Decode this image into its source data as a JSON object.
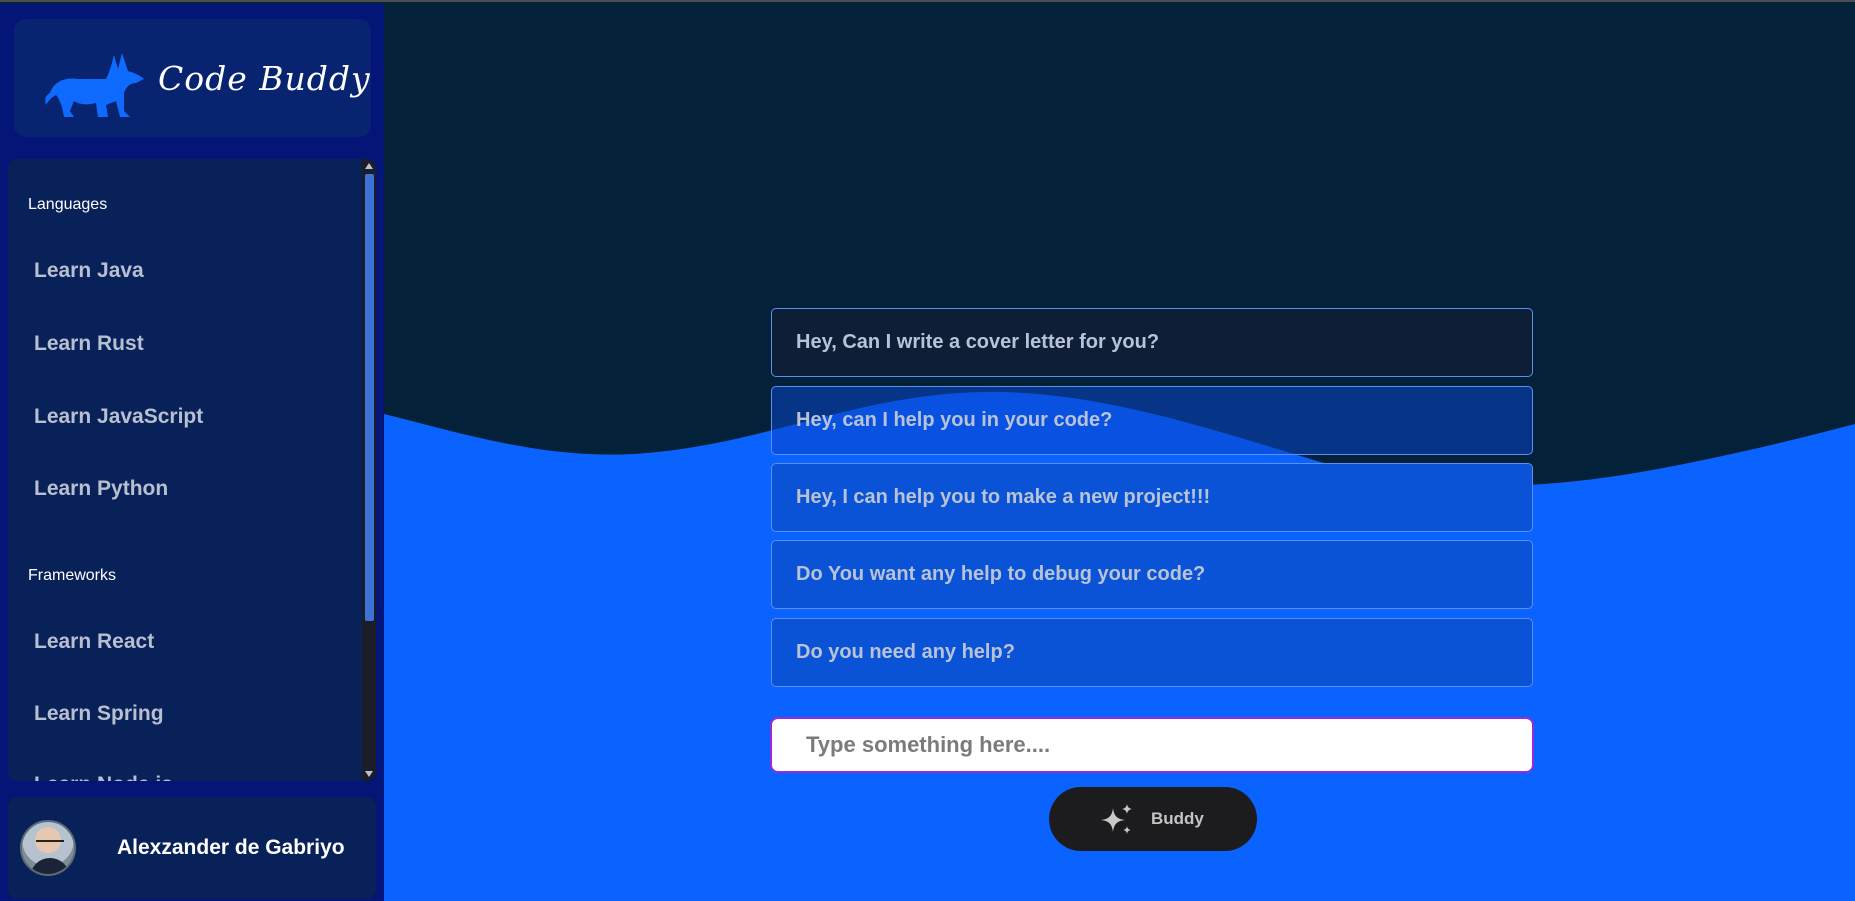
{
  "app": {
    "logo_text": "Code Buddy",
    "logo_icon": "dog-icon"
  },
  "sidebar": {
    "sections": [
      {
        "label": "Languages",
        "items": [
          "Learn Java",
          "Learn Rust",
          "Learn JavaScript",
          "Learn Python"
        ]
      },
      {
        "label": "Frameworks",
        "items": [
          "Learn React",
          "Learn Spring",
          "Learn Node.js"
        ]
      }
    ]
  },
  "user": {
    "name": "Alexzander de Gabriyo"
  },
  "suggestions": [
    "Hey, Can I write a cover letter for you?",
    "Hey, can I help you in your code?",
    "Hey, I can help you to make a new project!!!",
    "Do You want any help to debug your code?",
    "Do you need any help?"
  ],
  "input": {
    "placeholder": "Type something here....",
    "value": ""
  },
  "buddy_button": {
    "label": "Buddy",
    "icon": "sparkle-icon"
  },
  "colors": {
    "sidebar_bg": "#031678",
    "card_bg": "#082259",
    "dark_top": "#03223a",
    "wave_blue": "#0a63ff",
    "button_dark": "#1c1c1f"
  }
}
